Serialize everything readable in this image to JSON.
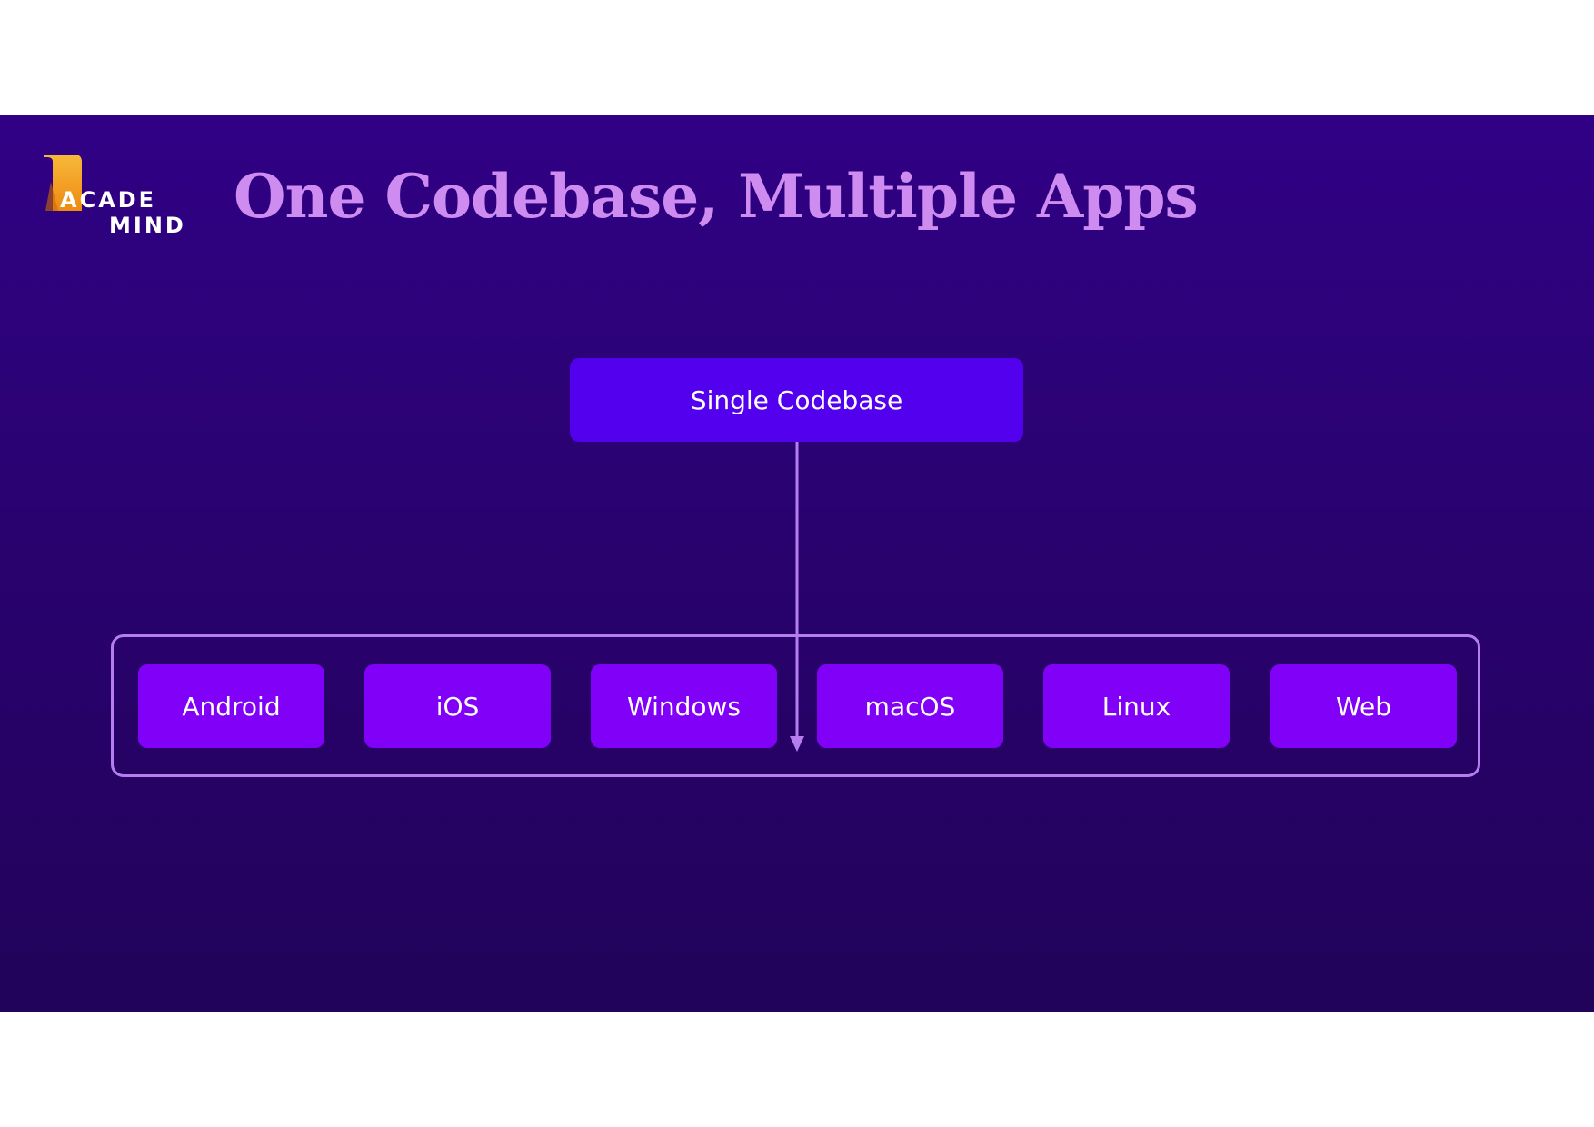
{
  "logo": {
    "line1": "ACADE",
    "line2": "MIND",
    "colors": {
      "mark": "#f5a623",
      "text": "#ffffff"
    }
  },
  "slide": {
    "title": "One Codebase, Multiple Apps",
    "colors": {
      "background_top": "#300185",
      "background_bottom": "#21035a",
      "title": "#cf8cf0"
    }
  },
  "diagram": {
    "root": {
      "label": "Single Codebase",
      "color": "#5200ed"
    },
    "edge_color": "#b47ef0",
    "target_color": "#8100f8",
    "targets": [
      "Android",
      "iOS",
      "Windows",
      "macOS",
      "Linux",
      "Web"
    ]
  }
}
